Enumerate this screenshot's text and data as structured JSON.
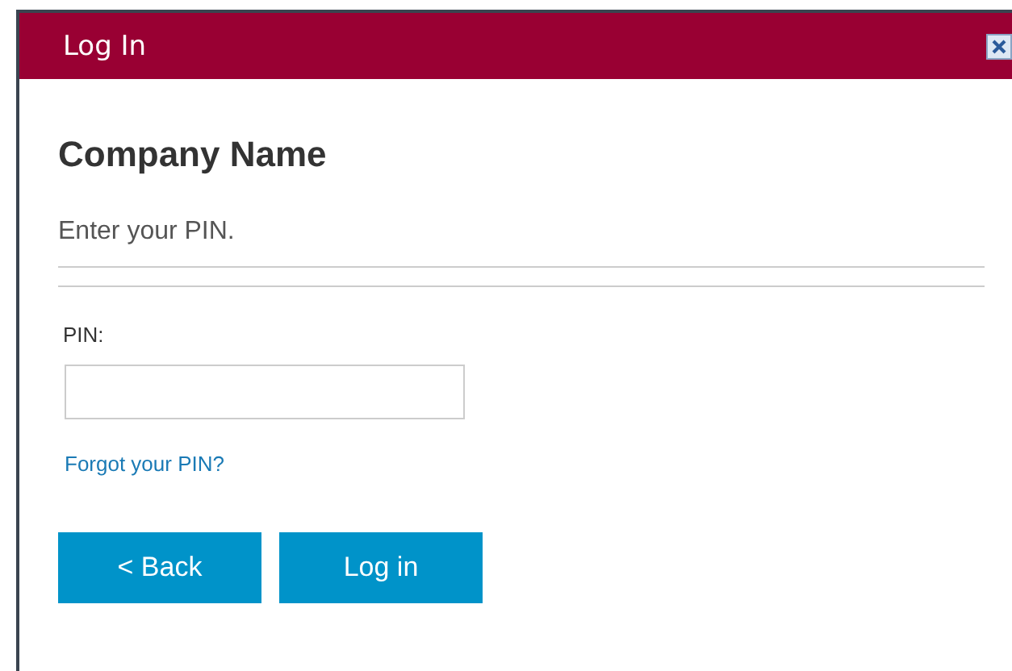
{
  "window": {
    "title": "Log In"
  },
  "heading": "Company Name",
  "instruction": "Enter your PIN.",
  "pin_field": {
    "label": "PIN:"
  },
  "forgot_link": "Forgot your PIN?",
  "buttons": [
    "< Back",
    "Log in"
  ]
}
